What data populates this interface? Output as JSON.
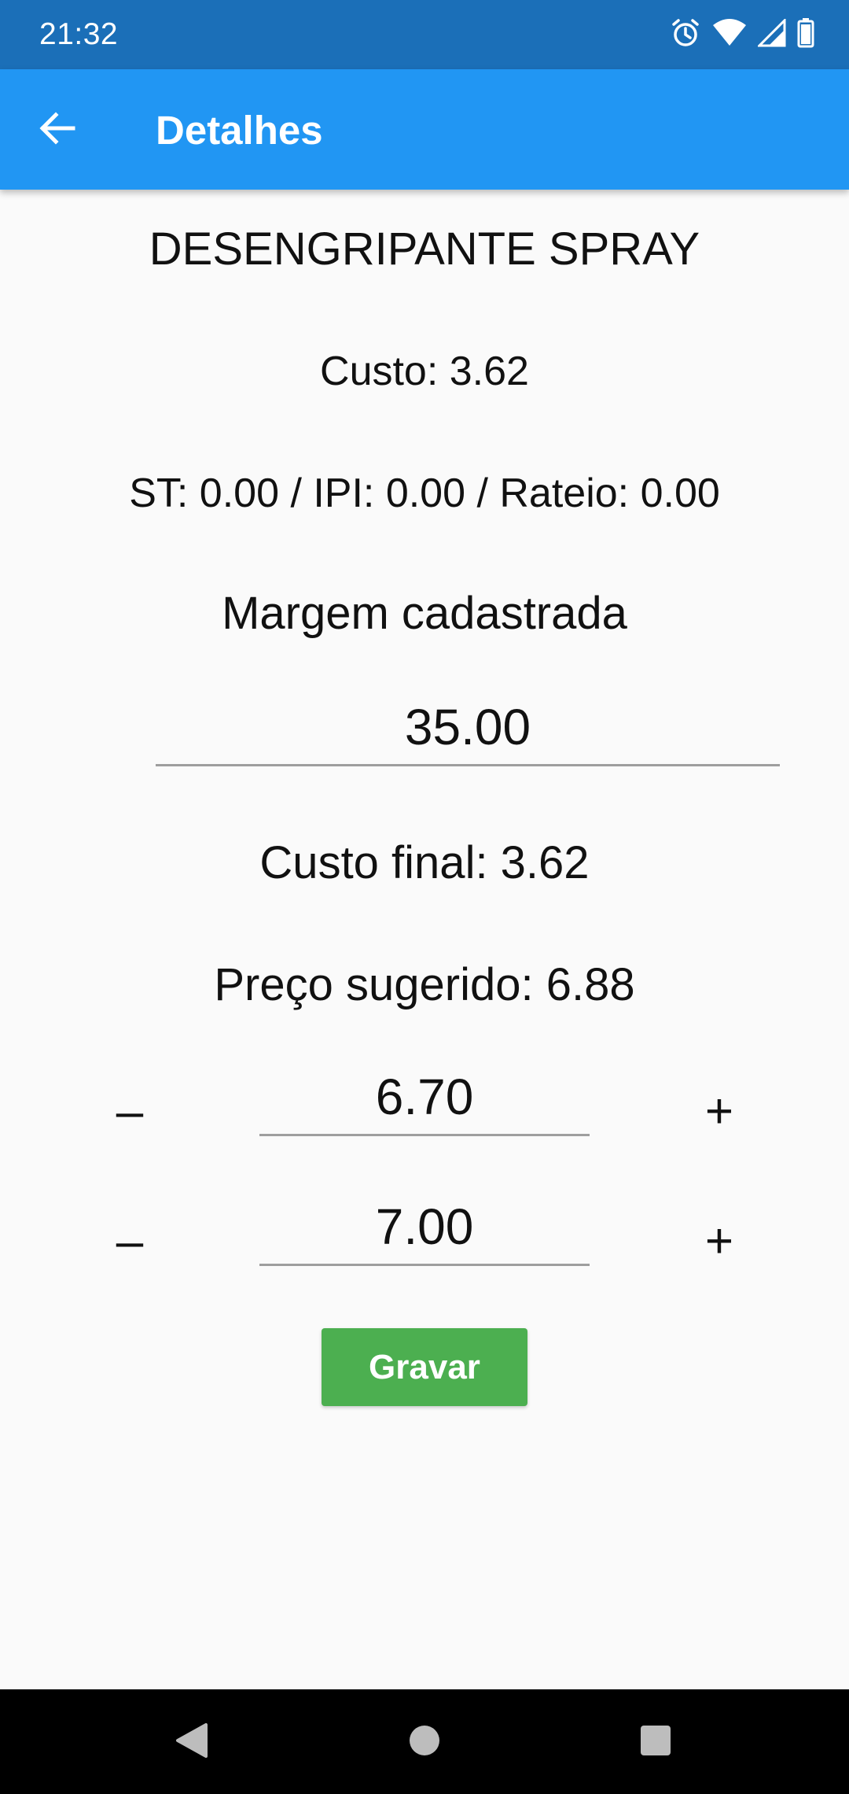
{
  "status_bar": {
    "time": "21:32",
    "icons": [
      "alarm-icon",
      "wifi-icon",
      "signal-icon",
      "battery-icon"
    ]
  },
  "app_bar": {
    "title": "Detalhes",
    "back_icon": "arrow-left-icon"
  },
  "product": {
    "name": "DESENGRIPANTE SPRAY",
    "cost_text": "Custo: 3.62",
    "taxes_text": "ST: 0.00 / IPI: 0.00 / Rateio: 0.00",
    "margin_label": "Margem cadastrada",
    "margin_value": "35.00",
    "final_cost_text": "Custo final: 3.62",
    "suggested_price_text": "Preço sugerido: 6.88"
  },
  "steppers": [
    {
      "minus": "–",
      "value": "6.70",
      "plus": "+"
    },
    {
      "minus": "–",
      "value": "7.00",
      "plus": "+"
    }
  ],
  "save_button": {
    "label": "Gravar"
  },
  "colors": {
    "status_bar": "#1b6fb8",
    "app_bar": "#2196f3",
    "save_button": "#4caf50",
    "background": "#fafafa",
    "nav_bar": "#000000"
  },
  "nav_bar": {
    "buttons": [
      "back-triangle-icon",
      "home-circle-icon",
      "recents-square-icon"
    ]
  }
}
